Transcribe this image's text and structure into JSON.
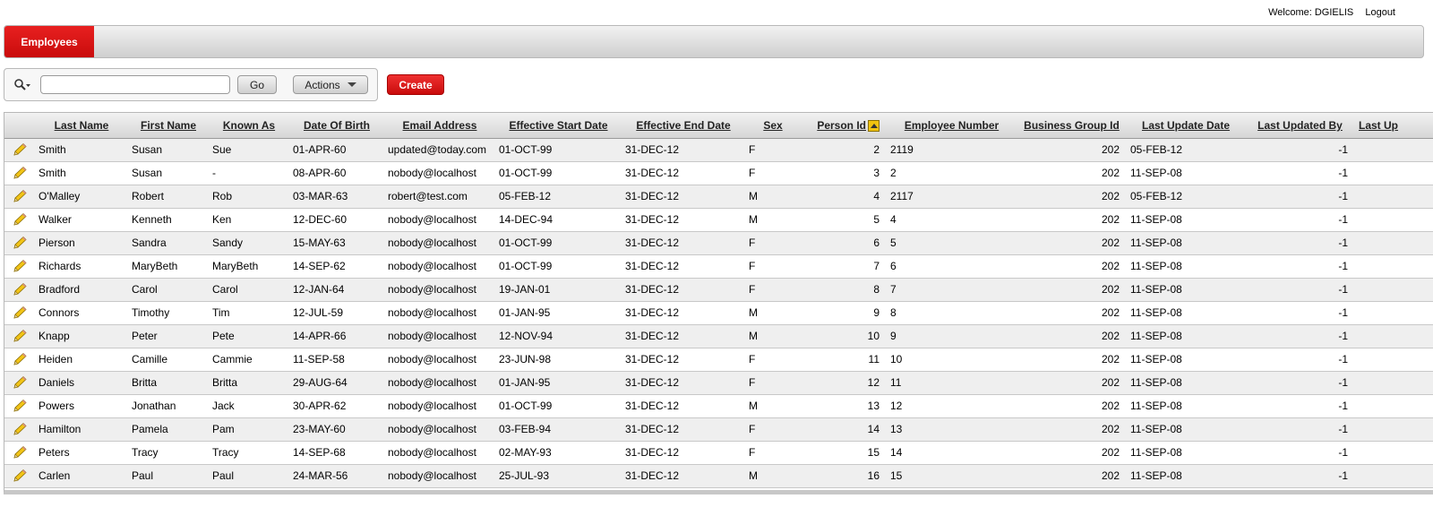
{
  "topbar": {
    "welcome": "Welcome: DGIELIS",
    "logout": "Logout"
  },
  "tabs": [
    {
      "label": "Employees",
      "active": true
    }
  ],
  "search": {
    "value": "",
    "placeholder": "",
    "go_label": "Go",
    "actions_label": "Actions"
  },
  "create_label": "Create",
  "colors": {
    "accent": "#d21414",
    "row_odd": "#efefef",
    "row_even": "#ffffff"
  },
  "table": {
    "columns": [
      "Last Name",
      "First Name",
      "Known As",
      "Date Of Birth",
      "Email Address",
      "Effective Start Date",
      "Effective End Date",
      "Sex",
      "Person Id",
      "Employee Number",
      "Business Group Id",
      "Last Update Date",
      "Last Updated By",
      "Last Up"
    ],
    "sorted_column": "Person Id",
    "sort_direction": "ascending",
    "rows": [
      [
        "Smith",
        "Susan",
        "Sue",
        "01-APR-60",
        "updated@today.com",
        "01-OCT-99",
        "31-DEC-12",
        "F",
        "2",
        "2119",
        "202",
        "05-FEB-12",
        "-1",
        ""
      ],
      [
        "Smith",
        "Susan",
        "-",
        "08-APR-60",
        "nobody@localhost",
        "01-OCT-99",
        "31-DEC-12",
        "F",
        "3",
        "2",
        "202",
        "11-SEP-08",
        "-1",
        ""
      ],
      [
        "O'Malley",
        "Robert",
        "Rob",
        "03-MAR-63",
        "robert@test.com",
        "05-FEB-12",
        "31-DEC-12",
        "M",
        "4",
        "2117",
        "202",
        "05-FEB-12",
        "-1",
        ""
      ],
      [
        "Walker",
        "Kenneth",
        "Ken",
        "12-DEC-60",
        "nobody@localhost",
        "14-DEC-94",
        "31-DEC-12",
        "M",
        "5",
        "4",
        "202",
        "11-SEP-08",
        "-1",
        ""
      ],
      [
        "Pierson",
        "Sandra",
        "Sandy",
        "15-MAY-63",
        "nobody@localhost",
        "01-OCT-99",
        "31-DEC-12",
        "F",
        "6",
        "5",
        "202",
        "11-SEP-08",
        "-1",
        ""
      ],
      [
        "Richards",
        "MaryBeth",
        "MaryBeth",
        "14-SEP-62",
        "nobody@localhost",
        "01-OCT-99",
        "31-DEC-12",
        "F",
        "7",
        "6",
        "202",
        "11-SEP-08",
        "-1",
        ""
      ],
      [
        "Bradford",
        "Carol",
        "Carol",
        "12-JAN-64",
        "nobody@localhost",
        "19-JAN-01",
        "31-DEC-12",
        "F",
        "8",
        "7",
        "202",
        "11-SEP-08",
        "-1",
        ""
      ],
      [
        "Connors",
        "Timothy",
        "Tim",
        "12-JUL-59",
        "nobody@localhost",
        "01-JAN-95",
        "31-DEC-12",
        "M",
        "9",
        "8",
        "202",
        "11-SEP-08",
        "-1",
        ""
      ],
      [
        "Knapp",
        "Peter",
        "Pete",
        "14-APR-66",
        "nobody@localhost",
        "12-NOV-94",
        "31-DEC-12",
        "M",
        "10",
        "9",
        "202",
        "11-SEP-08",
        "-1",
        ""
      ],
      [
        "Heiden",
        "Camille",
        "Cammie",
        "11-SEP-58",
        "nobody@localhost",
        "23-JUN-98",
        "31-DEC-12",
        "F",
        "11",
        "10",
        "202",
        "11-SEP-08",
        "-1",
        ""
      ],
      [
        "Daniels",
        "Britta",
        "Britta",
        "29-AUG-64",
        "nobody@localhost",
        "01-JAN-95",
        "31-DEC-12",
        "F",
        "12",
        "11",
        "202",
        "11-SEP-08",
        "-1",
        ""
      ],
      [
        "Powers",
        "Jonathan",
        "Jack",
        "30-APR-62",
        "nobody@localhost",
        "01-OCT-99",
        "31-DEC-12",
        "M",
        "13",
        "12",
        "202",
        "11-SEP-08",
        "-1",
        ""
      ],
      [
        "Hamilton",
        "Pamela",
        "Pam",
        "23-MAY-60",
        "nobody@localhost",
        "03-FEB-94",
        "31-DEC-12",
        "F",
        "14",
        "13",
        "202",
        "11-SEP-08",
        "-1",
        ""
      ],
      [
        "Peters",
        "Tracy",
        "Tracy",
        "14-SEP-68",
        "nobody@localhost",
        "02-MAY-93",
        "31-DEC-12",
        "F",
        "15",
        "14",
        "202",
        "11-SEP-08",
        "-1",
        ""
      ],
      [
        "Carlen",
        "Paul",
        "Paul",
        "24-MAR-56",
        "nobody@localhost",
        "25-JUL-93",
        "31-DEC-12",
        "M",
        "16",
        "15",
        "202",
        "11-SEP-08",
        "-1",
        ""
      ]
    ]
  }
}
